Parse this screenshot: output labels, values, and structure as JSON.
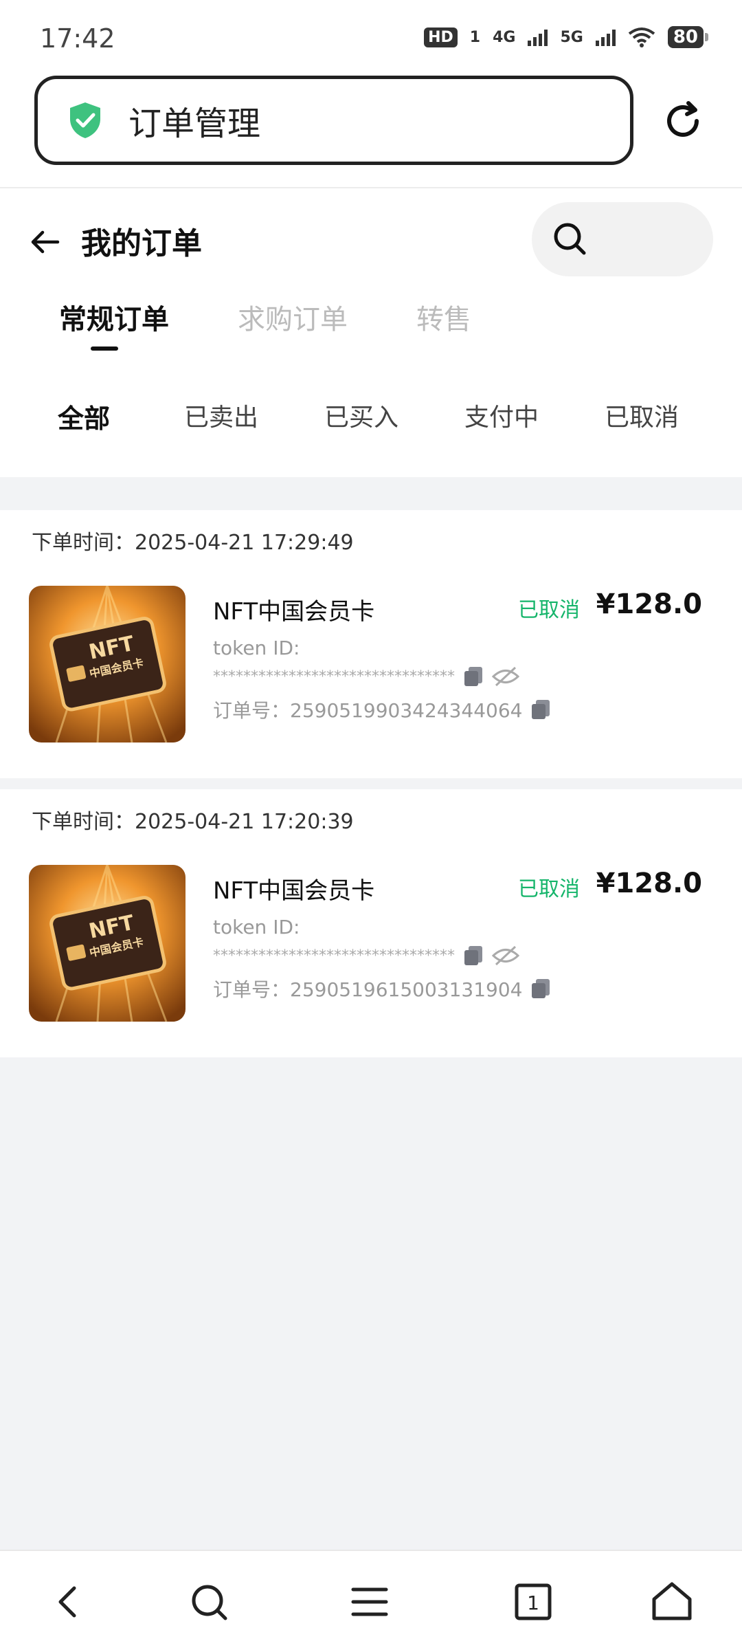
{
  "status_bar": {
    "time": "17:42",
    "hd": "HD",
    "hd_sub": "1",
    "net1": "4G",
    "net2": "5G",
    "battery": "80"
  },
  "browser": {
    "url_title": "订单管理",
    "secure_icon": "shield-check-icon",
    "reload_icon": "reload-icon"
  },
  "header": {
    "title": "我的订单",
    "back_icon": "arrow-left-icon",
    "search_icon": "search-icon"
  },
  "tabs": [
    {
      "label": "常规订单",
      "active": true
    },
    {
      "label": "求购订单",
      "active": false
    },
    {
      "label": "转售",
      "active": false
    }
  ],
  "filters": [
    {
      "label": "全部",
      "active": true
    },
    {
      "label": "已卖出",
      "active": false
    },
    {
      "label": "已买入",
      "active": false
    },
    {
      "label": "支付中",
      "active": false
    },
    {
      "label": "已取消",
      "active": false
    }
  ],
  "orders": [
    {
      "time_label": "下单时间：2025-04-21 17:29:49",
      "name": "NFT中国会员卡",
      "status": "已取消",
      "price": "¥128.0",
      "token_label": "token ID:",
      "token_masked": "********************************",
      "order_no": "订单号：2590519903424344064",
      "card_text_1": "NFT",
      "card_text_2": "中国会员卡"
    },
    {
      "time_label": "下单时间：2025-04-21 17:20:39",
      "name": "NFT中国会员卡",
      "status": "已取消",
      "price": "¥128.0",
      "token_label": "token ID:",
      "token_masked": "********************************",
      "order_no": "订单号：2590519615003131904",
      "card_text_1": "NFT",
      "card_text_2": "中国会员卡"
    }
  ],
  "nav": {
    "back_icon": "chevron-left-icon",
    "search_icon": "search-icon",
    "menu_icon": "menu-icon",
    "tabs_icon": "tabs-count-icon",
    "tabs_count": "1",
    "home_icon": "home-icon"
  },
  "colors": {
    "accent_green": "#16b56b",
    "shield_green": "#3ec27f"
  }
}
